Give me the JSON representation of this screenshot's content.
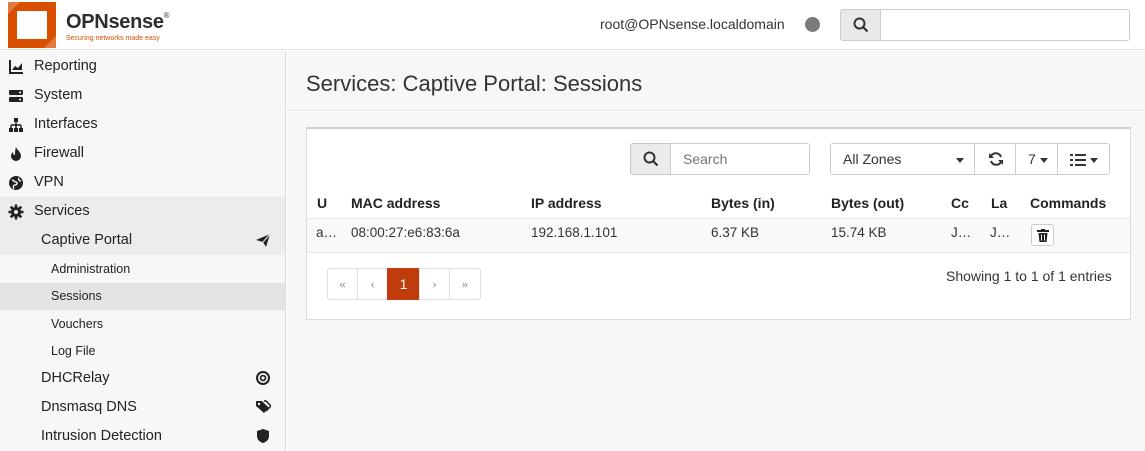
{
  "brand": {
    "name": "OPNsense",
    "tagline": "Securing networks made easy",
    "accent": "#d94f00"
  },
  "header": {
    "user": "root@OPNsense.localdomain",
    "search_placeholder": ""
  },
  "sidebar": {
    "items": [
      {
        "label": "Reporting",
        "icon": "chart-icon"
      },
      {
        "label": "System",
        "icon": "server-icon"
      },
      {
        "label": "Interfaces",
        "icon": "sitemap-icon"
      },
      {
        "label": "Firewall",
        "icon": "fire-icon"
      },
      {
        "label": "VPN",
        "icon": "globe-icon"
      },
      {
        "label": "Services",
        "icon": "gear-icon"
      }
    ],
    "services_sub": [
      {
        "label": "Captive Portal",
        "icon": "paper-plane-icon"
      },
      {
        "label": "DHCRelay",
        "icon": "bullseye-icon"
      },
      {
        "label": "Dnsmasq DNS",
        "icon": "tags-icon"
      },
      {
        "label": "Intrusion Detection",
        "icon": "shield-icon"
      }
    ],
    "captive_sub": [
      "Administration",
      "Sessions",
      "Vouchers",
      "Log File"
    ]
  },
  "page": {
    "title": "Services: Captive Portal: Sessions"
  },
  "toolbar": {
    "search_placeholder": "Search",
    "zones": "All Zones",
    "rows": "7"
  },
  "table": {
    "columns": [
      "U",
      "MAC address",
      "IP address",
      "Bytes (in)",
      "Bytes (out)",
      "Cc",
      "La",
      "Commands"
    ],
    "rows": [
      {
        "user": "a…",
        "mac": "08:00:27:e6:83:6a",
        "ip": "192.168.1.101",
        "bytes_in": "6.37 KB",
        "bytes_out": "15.74 KB",
        "connected": "J…",
        "last": "J…"
      }
    ]
  },
  "pagination": {
    "first": "«",
    "prev": "‹",
    "page": "1",
    "next": "›",
    "last": "»",
    "summary": "Showing 1 to 1 of 1 entries"
  }
}
